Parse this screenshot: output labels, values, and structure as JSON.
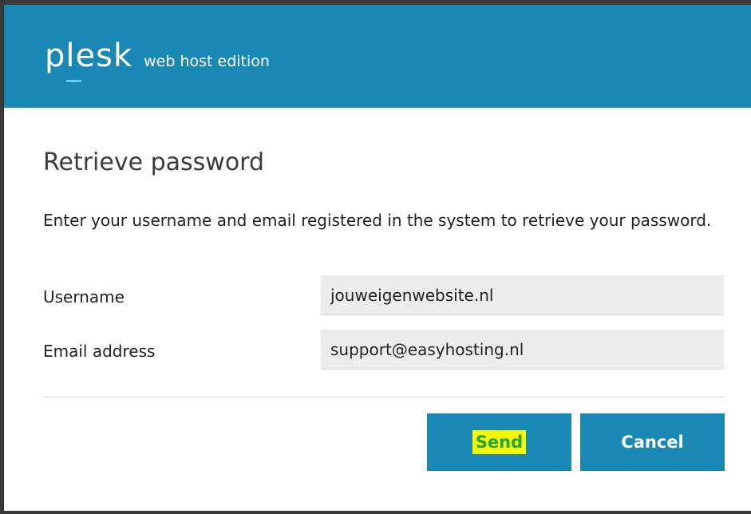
{
  "header": {
    "logo_word": "plesk",
    "edition": "web host edition"
  },
  "page": {
    "title": "Retrieve password",
    "description": "Enter your username and email registered in the system to retrieve your password."
  },
  "form": {
    "username": {
      "label": "Username",
      "value": "jouweigenwebsite.nl"
    },
    "email": {
      "label": "Email address",
      "value": "support@easyhosting.nl"
    }
  },
  "actions": {
    "send_label": "Send",
    "cancel_label": "Cancel"
  },
  "colors": {
    "brand": "#1a88b5",
    "logo_accent": "#5fd1ff",
    "highlight": "#f6f600"
  }
}
